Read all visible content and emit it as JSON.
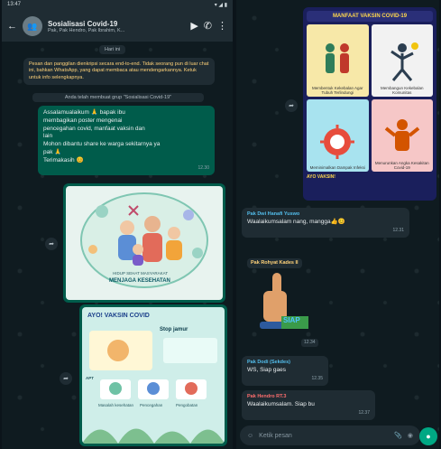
{
  "left": {
    "status": {
      "time": "13:47",
      "right": "▾ ◢ ▮"
    },
    "header": {
      "title": "Sosialisasi Covid-19",
      "subtitle": "Pak, Pak Hendro, Pak Ibrahim, K...",
      "back": "←",
      "video": "▶",
      "call": "✆",
      "menu": "⋮"
    },
    "day_chip": "Hari ini",
    "system_notice": "Pesan dan panggilan dienkripsi secara end-to-end. Tidak seorang pun di luar chat ini, bahkan WhatsApp, yang dapat membaca atau mendengarkannya. Ketuk untuk info selengkapnya.",
    "group_created": "Anda telah membuat grup \"Sosialisasi Covid-19\"",
    "message_out": {
      "lines": [
        "Assalamualaikum 🙏 bapak ibu",
        "membagikan poster mengenai",
        "pencegahan covid, manfaat vaksin dan",
        "lain",
        "Mohon dibantu share ke warga sekitarnya ya",
        "pak 🙏",
        "Terimakasih 😊"
      ],
      "time": "12.30"
    },
    "poster1": {
      "caption": "MENJAGA KESEHATAN",
      "sub": "HIDUP SEHAT MASYARAKAT"
    },
    "poster2": {
      "heading": "AYO! VAKSIN COVID",
      "sub": "Stop jamur",
      "label_left": "APT",
      "labels": [
        "Masalah kesehatan",
        "Pencegahan",
        "Pengobatan"
      ]
    },
    "fwd_icon": "➦"
  },
  "right": {
    "infographic": {
      "title": "MANFAAT VAKSIN COVID-19",
      "cells": [
        {
          "label": "Membentuk Kekebalan Agar Tubuh Terlindungi",
          "color": "#f7e8a8"
        },
        {
          "label": "Membangun Kekebalan Komunitas",
          "color": "#f2f2f2"
        },
        {
          "label": "Meminimalkan Dampak Infeksi",
          "color": "#a8e3ef"
        },
        {
          "label": "Menurunkan Angka Kesakitan Covid-19",
          "color": "#f6c7c7"
        }
      ],
      "footer": "AYO VAKSIN!"
    },
    "messages": [
      {
        "sender": "Pak Dwi Hanafi Yuswo",
        "sender_color": "#53bdeb",
        "text": "Waalaikumsalam nang, mangga👍😊",
        "time": "12.31"
      },
      {
        "sender": "Pak Rohyat Kades II",
        "sender_color": "#ffd279",
        "text": "",
        "time": "12.34"
      },
      {
        "sender": "Pak Dodi (Sekdes)",
        "sender_color": "#53bdeb",
        "text": "WS, Siap gaes",
        "time": "12.35"
      },
      {
        "sender": "Pak Hendro RT.3",
        "sender_color": "#ff6e6e",
        "text": "Waalaikumsalam. Siap bu",
        "time": "12.37"
      }
    ],
    "input": {
      "placeholder": "Ketik pesan",
      "attach": "📎",
      "camera": "◉",
      "emoji": "☺",
      "mic": "●"
    },
    "sticker_text": "SIAP",
    "fwd_icon": "➦"
  },
  "colors": {
    "header": "#1f2c33",
    "outgoing": "#005c4b",
    "incoming": "#1f2c33",
    "accent": "#00a884"
  }
}
